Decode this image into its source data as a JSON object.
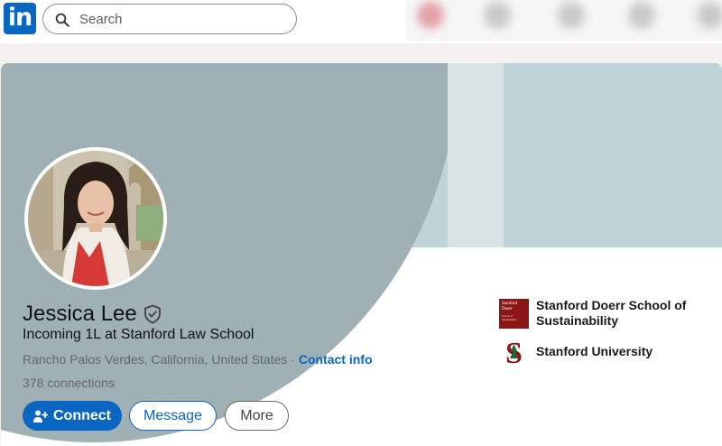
{
  "nav": {
    "logo_text": "in",
    "search_placeholder": "Search",
    "brand_color": "#0a66c2"
  },
  "profile": {
    "name": "Jessica Lee",
    "headline": "Incoming 1L at Stanford Law School",
    "location": "Rancho Palos Verdes, California, United States",
    "separator": " · ",
    "contact_info": "Contact info",
    "connections_count": "378",
    "connections_label": " connections",
    "verified_icon": "shield-check-icon"
  },
  "actions": {
    "connect": "Connect",
    "message": "Message",
    "more": "More"
  },
  "organizations": [
    {
      "name": "Stanford Doerr School of Sustainability",
      "logo_text_line1": "Stanford Doerr",
      "logo_text_line2": "School of Sustainability"
    },
    {
      "name": "Stanford University",
      "logo_text": "S"
    }
  ]
}
